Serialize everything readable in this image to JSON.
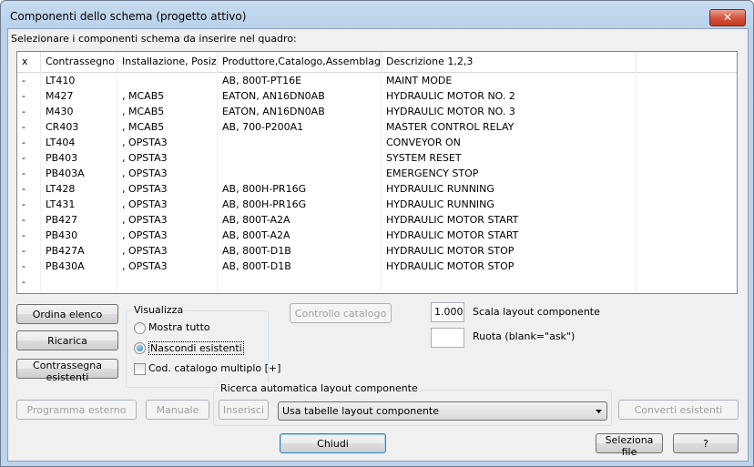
{
  "window": {
    "title": "Componenti dello schema (progetto attivo)",
    "close_glyph": "✕"
  },
  "instruction": "Selezionare i componenti schema da inserire nel quadro:",
  "list": {
    "columns": [
      "x",
      "Contrassegno",
      "Installazione, Posiz...",
      "Produttore,Catalogo,Assemblaggio",
      "Descrizione 1,2,3"
    ],
    "rows": [
      [
        "-",
        "LT410",
        "",
        "AB, 800T-PT16E",
        "MAINT MODE"
      ],
      [
        "-",
        "M427",
        ", MCAB5",
        "EATON, AN16DN0AB",
        "HYDRAULIC MOTOR NO. 2"
      ],
      [
        "-",
        "M430",
        ", MCAB5",
        "EATON, AN16DN0AB",
        "HYDRAULIC MOTOR NO. 3"
      ],
      [
        "-",
        "CR403",
        ", MCAB5",
        "AB, 700-P200A1",
        "MASTER CONTROL RELAY"
      ],
      [
        "-",
        "LT404",
        ", OPSTA3",
        "",
        "CONVEYOR ON"
      ],
      [
        "-",
        "PB403",
        ", OPSTA3",
        "",
        "SYSTEM RESET"
      ],
      [
        "-",
        "PB403A",
        ", OPSTA3",
        "",
        "EMERGENCY STOP"
      ],
      [
        "-",
        "LT428",
        ", OPSTA3",
        "AB, 800H-PR16G",
        "HYDRAULIC RUNNING"
      ],
      [
        "-",
        "LT431",
        ", OPSTA3",
        "AB, 800H-PR16G",
        "HYDRAULIC RUNNING"
      ],
      [
        "-",
        "PB427",
        ", OPSTA3",
        "AB, 800T-A2A",
        "HYDRAULIC MOTOR START"
      ],
      [
        "-",
        "PB430",
        ", OPSTA3",
        "AB, 800T-A2A",
        "HYDRAULIC MOTOR START"
      ],
      [
        "-",
        "PB427A",
        ", OPSTA3",
        "AB, 800T-D1B",
        "HYDRAULIC MOTOR STOP"
      ],
      [
        "-",
        "PB430A",
        ", OPSTA3",
        "AB, 800T-D1B",
        "HYDRAULIC MOTOR STOP"
      ],
      [
        "-",
        "",
        "",
        "",
        ""
      ]
    ]
  },
  "buttons": {
    "sort": "Ordina elenco",
    "reload": "Ricarica",
    "mark_existing": "Contrassegna esistenti",
    "catalog_check": "Controllo catalogo",
    "external_program": "Programma esterno",
    "manual": "Manuale",
    "insert": "Inserisci",
    "convert_existing": "Converti esistenti",
    "close": "Chiudi",
    "select_file": "Seleziona file",
    "help": "?"
  },
  "visualizza": {
    "title": "Visualizza",
    "show_all": "Mostra tutto",
    "hide_existing": "Nascondi esistenti",
    "selected": "hide_existing",
    "multi_catalog": "Cod. catalogo multiplo [+]",
    "multi_catalog_checked": false
  },
  "layout": {
    "scale_value": "1.000",
    "scale_label": "Scala layout componente",
    "rotate_value": "",
    "rotate_label": "Ruota (blank=\"ask\")"
  },
  "auto_search": {
    "title": "Ricerca automatica layout componente",
    "combo_value": "Usa tabelle layout componente",
    "combo_icon": "chevron-down-icon"
  }
}
